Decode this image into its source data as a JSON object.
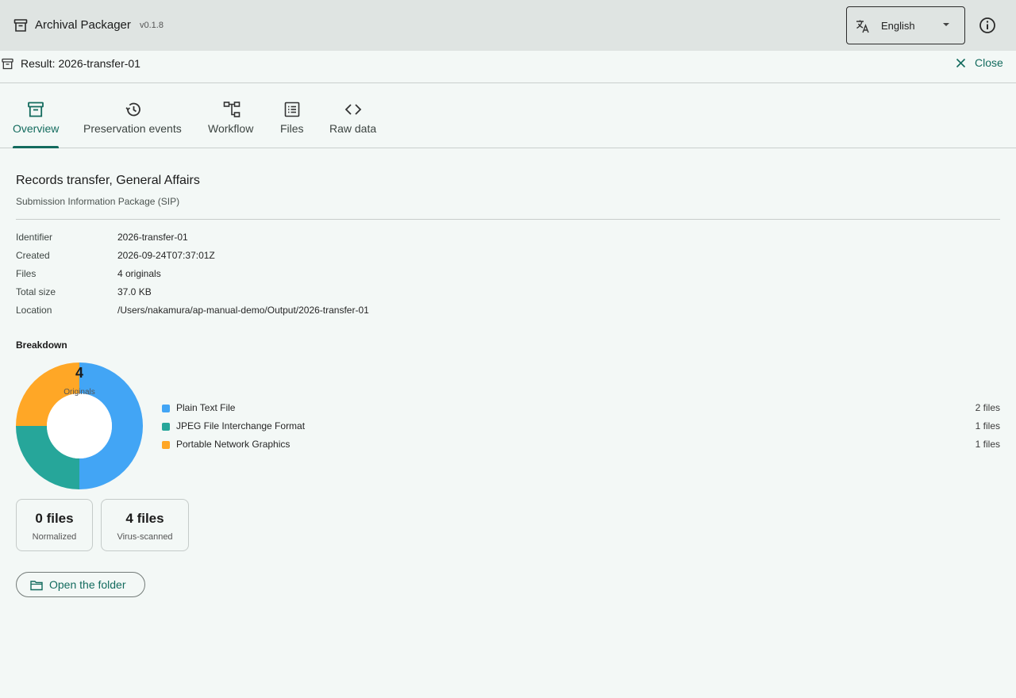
{
  "app": {
    "title": "Archival Packager",
    "version": "v0.1.8",
    "icon": "archive-icon"
  },
  "language_select": {
    "value": "English",
    "icon": "translate-icon"
  },
  "info_button": {
    "icon": "info-icon"
  },
  "result": {
    "title": "Result: 2026-transfer-01",
    "close_label": "Close"
  },
  "tabs": [
    {
      "label": "Overview",
      "icon": "archive-icon",
      "active": true
    },
    {
      "label": "Preservation events",
      "icon": "history-icon",
      "active": false
    },
    {
      "label": "Workflow",
      "icon": "workflow-icon",
      "active": false
    },
    {
      "label": "Files",
      "icon": "list-icon",
      "active": false
    },
    {
      "label": "Raw data",
      "icon": "code-icon",
      "active": false
    }
  ],
  "overview": {
    "title": "Records transfer, General Affairs",
    "subtitle": "Submission Information Package (SIP)",
    "metadata": [
      {
        "key": "Identifier",
        "value": "2026-transfer-01"
      },
      {
        "key": "Created",
        "value": "2026-09-24T07:37:01Z"
      },
      {
        "key": "Files",
        "value": "4 originals"
      },
      {
        "key": "Total size",
        "value": "37.0 KB"
      },
      {
        "key": "Location",
        "value": "/Users/nakamura/ap-manual-demo/Output/2026-transfer-01"
      }
    ]
  },
  "breakdown": {
    "title": "Breakdown",
    "total": "4",
    "total_caption": "Originals",
    "items": [
      {
        "label": "Plain Text File",
        "count": "2 files",
        "value": 2,
        "color": "#42a5f5"
      },
      {
        "label": "JPEG File Interchange Format",
        "count": "1 files",
        "value": 1,
        "color": "#26a69a"
      },
      {
        "label": "Portable Network Graphics",
        "count": "1 files",
        "value": 1,
        "color": "#ffa726"
      }
    ]
  },
  "stats": [
    {
      "value": "0 files",
      "label": "Normalized"
    },
    {
      "value": "4 files",
      "label": "Virus-scanned"
    }
  ],
  "open_folder": {
    "label": "Open the folder",
    "icon": "folder-icon"
  },
  "colors": {
    "accent": "#136b5e",
    "appbar": "#dfe4e2",
    "background": "#f3f8f6"
  }
}
